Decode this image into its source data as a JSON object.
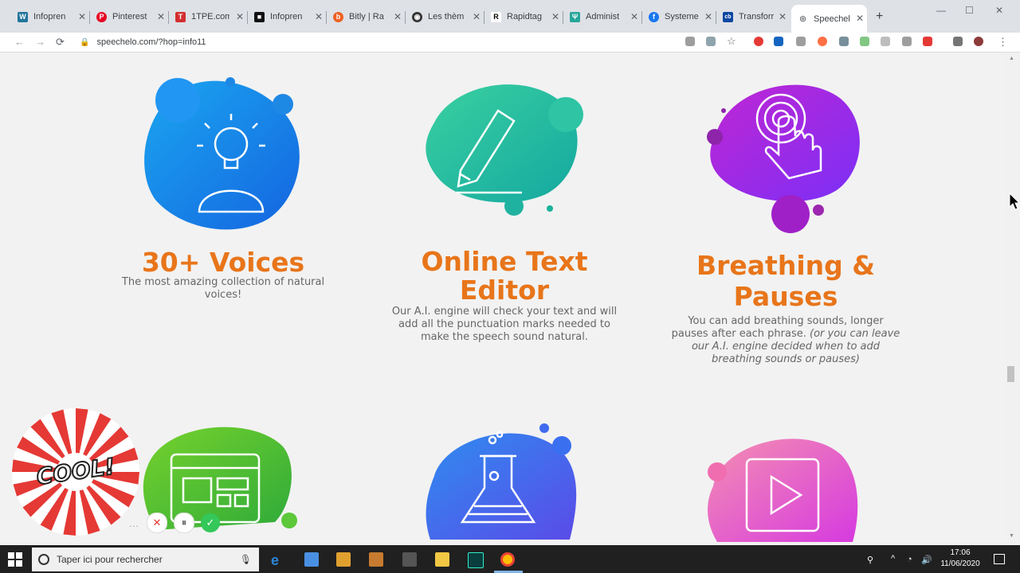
{
  "browser": {
    "tabs": [
      {
        "title": "Infopren",
        "fav_color": "#21759b",
        "fav_glyph": "W"
      },
      {
        "title": "Pinterest",
        "fav_color": "#e60023",
        "fav_glyph": "P"
      },
      {
        "title": "1TPE.com",
        "fav_color": "#d32f2f",
        "fav_glyph": "T"
      },
      {
        "title": "Infopren",
        "fav_color": "#111111",
        "fav_glyph": "■"
      },
      {
        "title": "Bitly | Ra",
        "fav_color": "#ee6123",
        "fav_glyph": "b"
      },
      {
        "title": "Les thèm",
        "fav_color": "#333333",
        "fav_glyph": "◉"
      },
      {
        "title": "Rapidtag",
        "fav_color": "#000000",
        "fav_glyph": "R"
      },
      {
        "title": "Administ",
        "fav_color": "#26a69a",
        "fav_glyph": "Ψ"
      },
      {
        "title": "Systeme",
        "fav_color": "#1877f2",
        "fav_glyph": "f"
      },
      {
        "title": "Transforr",
        "fav_color": "#0d47a1",
        "fav_glyph": "cb"
      },
      {
        "title": "Speechel",
        "fav_color": "#5f6368",
        "fav_glyph": "◎",
        "active": true
      }
    ],
    "new_tab": "+",
    "url": "speechelo.com/?hop=info11"
  },
  "features": [
    {
      "title_lines": [
        "30+ Voices"
      ],
      "desc": "The most amazing collection of natural voices!",
      "icon": "lightbulb-person-icon"
    },
    {
      "title_lines": [
        "Online Text",
        "Editor"
      ],
      "desc": "Our A.I. engine will check your text and will add all the punctuation marks needed to make the speech sound natural.",
      "icon": "pencil-icon"
    },
    {
      "title_lines": [
        "Breathing &",
        "Pauses"
      ],
      "desc": "You can add breathing sounds, longer pauses after each phrase.",
      "desc_italic": "(or you can leave our A.I. engine decided when to add breathing sounds or pauses)",
      "icon": "touch-hand-icon"
    }
  ],
  "row2_icons": [
    "web-layout-icon",
    "flask-icon",
    "play-icon"
  ],
  "overlay": {
    "cool": "COOL!",
    "buttons": [
      "…",
      "✕",
      "⏸",
      "✓"
    ]
  },
  "taskbar": {
    "search_placeholder": "Taper ici pour rechercher",
    "time": "17:06",
    "date": "11/06/2020"
  },
  "colors": {
    "title_orange": "#e8751a",
    "blue_blob": "#1e88e5",
    "teal_blob": "#26c6a6",
    "purple_blob": "#9c27b0",
    "green_blob": "#4caf50",
    "pink_blob": "#f06292"
  }
}
